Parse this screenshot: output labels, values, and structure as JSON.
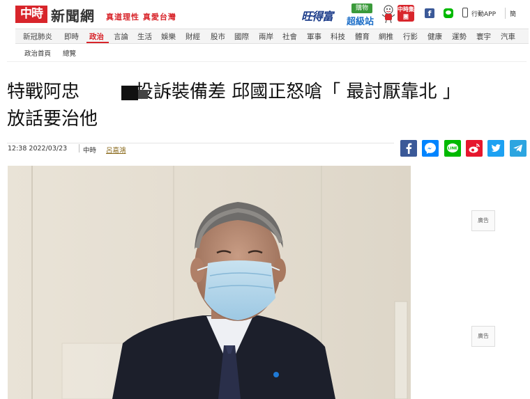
{
  "header": {
    "logo_mark": "中時",
    "site_name": "新聞網",
    "slogan": "真道理性 真愛台灣",
    "partner_brand": "旺得富",
    "shop_tag": "購物",
    "shop_name": "超級站",
    "group_badge": "中時集團",
    "fb_glyph": "f",
    "app_label": "行動APP",
    "lang_label": "簡",
    "accent_color": "#d8252b"
  },
  "nav": {
    "items": [
      "新冠肺炎",
      "即時",
      "政治",
      "言論",
      "生活",
      "娛樂",
      "財經",
      "股市",
      "國際",
      "兩岸",
      "社會",
      "軍事",
      "科技",
      "體育",
      "網推",
      "行影",
      "健康",
      "運勢",
      "寰宇",
      "汽車"
    ],
    "active_index": 2,
    "sub_items": [
      "政治首頁",
      "總覽"
    ]
  },
  "article": {
    "headline_line1_part1": "特戰阿忠",
    "headline_line1_part2": "投訴裝備差 邱國正怒嗆「 最討厭靠北 」",
    "headline_line2": "放話要治他",
    "date": "12:38  2022/03/23",
    "source": "中時",
    "reporter": "呂嘉鴻"
  },
  "share_icons": [
    "facebook-icon",
    "messenger-icon",
    "line-icon",
    "weibo-icon",
    "twitter-icon",
    "telegram-icon"
  ],
  "share_colors": {
    "facebook": "#3b5998",
    "messenger": "#0084ff",
    "line": "#00b900",
    "weibo": "#e6162d",
    "twitter": "#1da1f2",
    "telegram": "#2ca5e0"
  },
  "ads": [
    "廣告",
    "廣告"
  ]
}
